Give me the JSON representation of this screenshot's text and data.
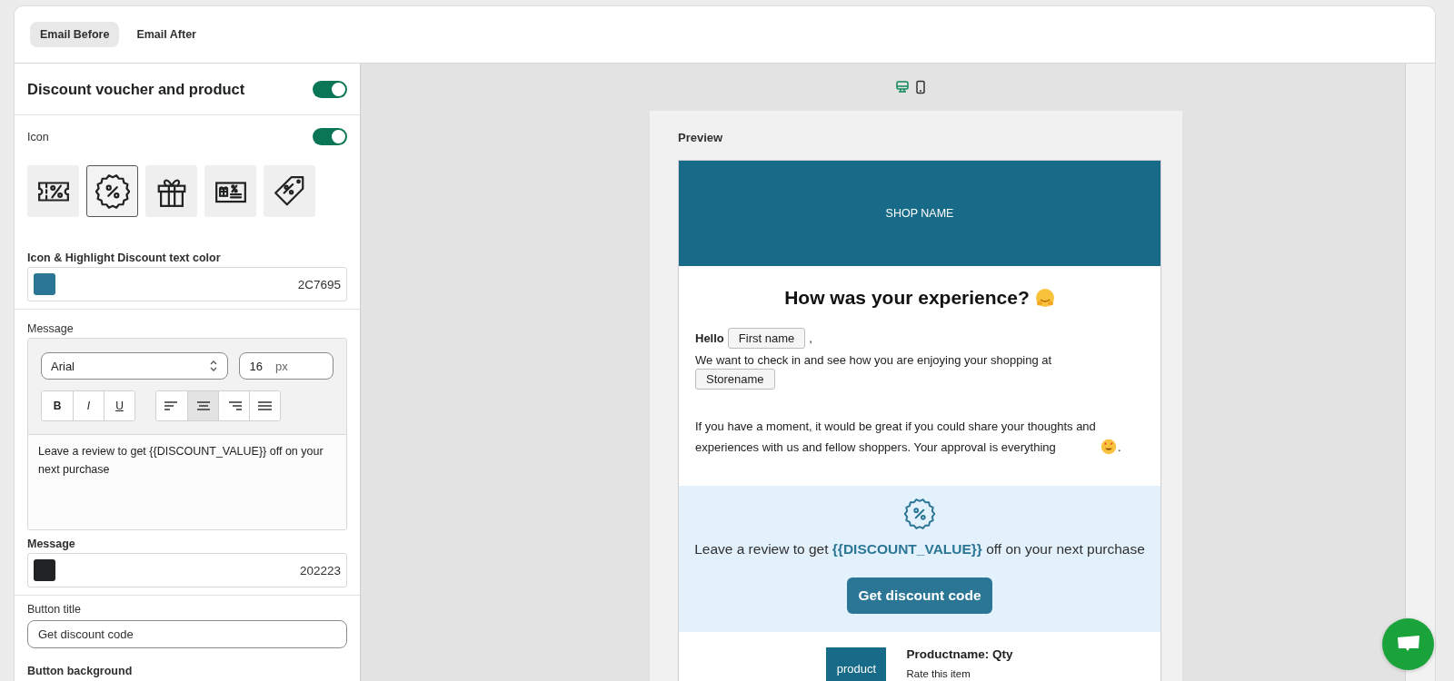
{
  "tabs": [
    {
      "label": "Email Before",
      "selected": true
    },
    {
      "label": "Email After",
      "selected": false
    }
  ],
  "settings": {
    "section": {
      "title": "Discount voucher and product",
      "on": true
    },
    "icon": {
      "label": "Icon",
      "on": true,
      "options": [
        {
          "kind": "ticket",
          "selected": false
        },
        {
          "kind": "badge",
          "selected": true
        },
        {
          "kind": "gift",
          "selected": false
        },
        {
          "kind": "voucher",
          "selected": false
        },
        {
          "kind": "tag",
          "selected": false
        }
      ]
    },
    "highlight_color": {
      "label": "Icon & Highlight Discount text color",
      "value": "2C7695"
    },
    "message_editor": {
      "label": "Message",
      "font": "Arial",
      "size": "16",
      "unit": "px",
      "styles": [
        {
          "kind": "bold",
          "label": "B"
        },
        {
          "kind": "italic",
          "label": "I"
        },
        {
          "kind": "underline",
          "label": "U"
        }
      ],
      "alignments": [
        {
          "kind": "left",
          "selected": false
        },
        {
          "kind": "center",
          "selected": true
        },
        {
          "kind": "right",
          "selected": false
        },
        {
          "kind": "justify",
          "selected": false
        }
      ],
      "text": "Leave a review to get {{DISCOUNT_VALUE}} off on your next purchase"
    },
    "message_color": {
      "label": "Message",
      "value": "202223"
    },
    "button_title": {
      "label": "Button title",
      "value": "Get discount code"
    },
    "button_background": {
      "label": "Button background"
    }
  },
  "preview": {
    "devices": [
      {
        "kind": "desktop",
        "selected": true
      },
      {
        "kind": "mobile",
        "selected": false
      }
    ],
    "title": "Preview",
    "email": {
      "shop_name": "SHOP NAME",
      "heading": "How was your experience?",
      "greeting": "Hello",
      "first_name": "First name",
      "greeting_end": ",",
      "intro": "We want to check in and see how you are enjoying your shopping at",
      "store_name": "Storename",
      "body": "If you have a moment, it would be great if you could share your thoughts and experiences with us and fellow shoppers. Your approval is everything",
      "body_end": ".",
      "discount_text": "Leave a review to get **{{DISCOUNT_VALUE}}** off on your next purchase",
      "discount_button": "Get discount code",
      "product": {
        "photo_text": "product",
        "name": "Productname: Qty",
        "rating_label": "Rate this item"
      }
    }
  }
}
